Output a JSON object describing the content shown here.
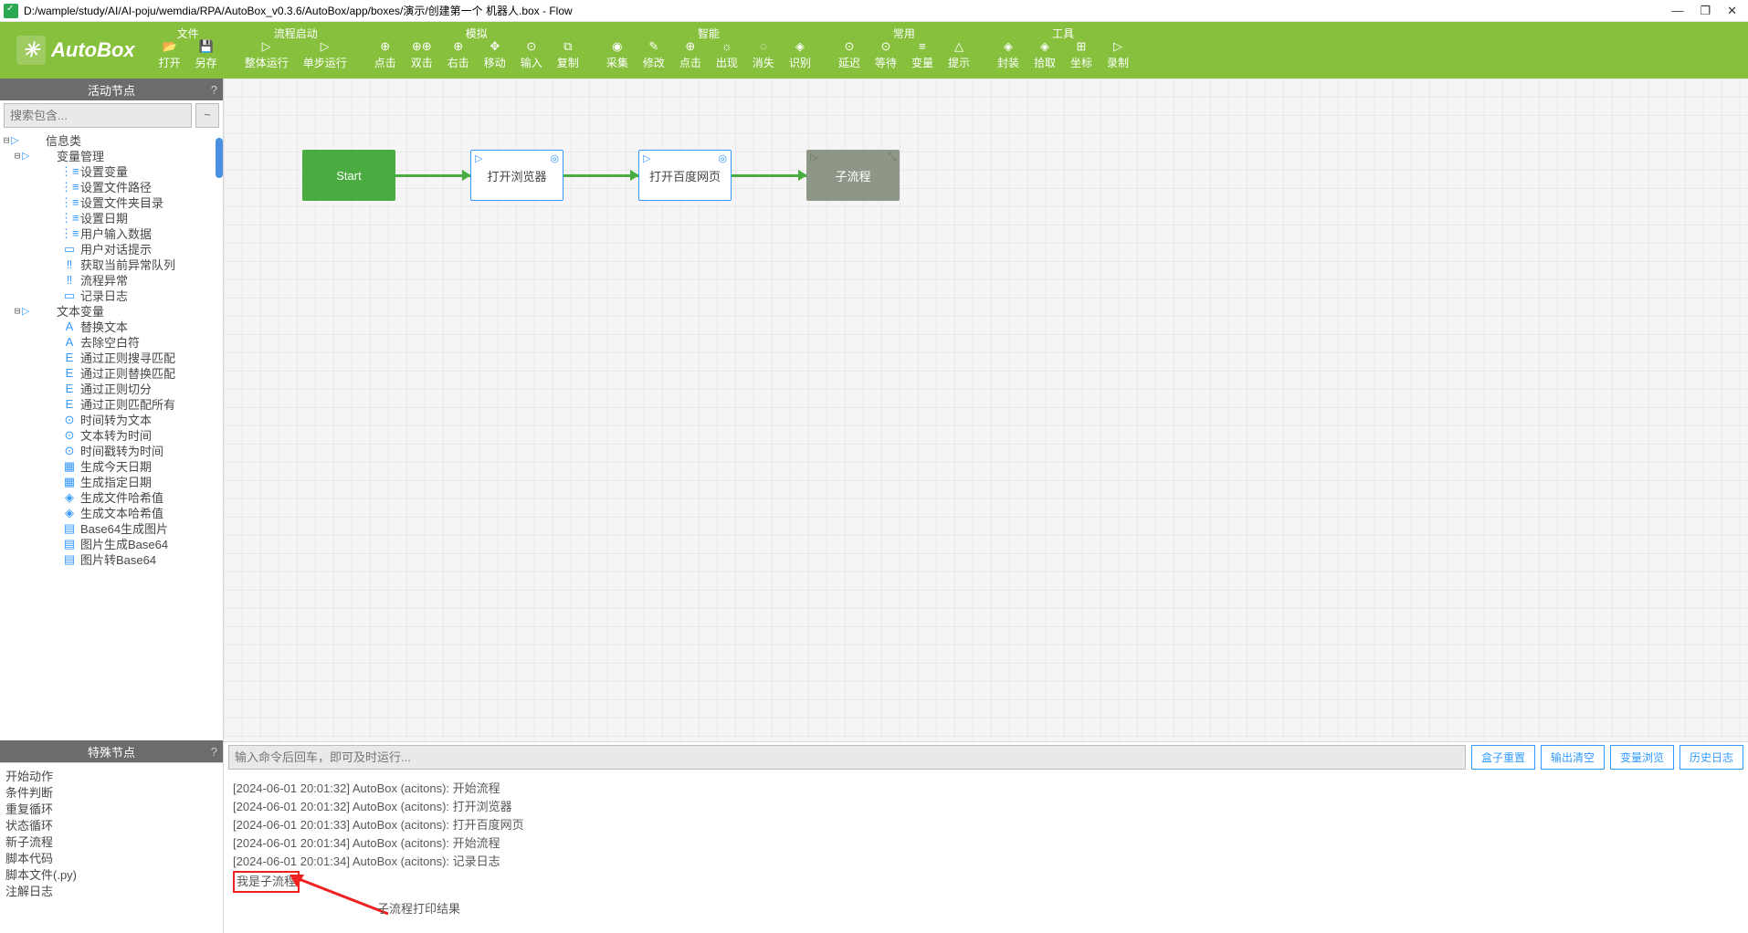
{
  "window": {
    "title": "D:/wample/study/AI/AI-poju/wemdia/RPA/AutoBox_v0.3.6/AutoBox/app/boxes/演示/创建第一个 机器人.box - Flow"
  },
  "logo": "AutoBox",
  "toolbar": {
    "groups": [
      {
        "title": "文件",
        "items": [
          {
            "icon": "📂",
            "label": "打开"
          },
          {
            "icon": "💾",
            "label": "另存"
          }
        ]
      },
      {
        "title": "流程启动",
        "items": [
          {
            "icon": "▷",
            "label": "整体运行"
          },
          {
            "icon": "▷",
            "label": "单步运行"
          }
        ]
      },
      {
        "title": "模拟",
        "items": [
          {
            "icon": "⊕",
            "label": "点击"
          },
          {
            "icon": "⊕⊕",
            "label": "双击"
          },
          {
            "icon": "⊕",
            "label": "右击"
          },
          {
            "icon": "✥",
            "label": "移动"
          },
          {
            "icon": "⊙",
            "label": "输入"
          },
          {
            "icon": "⧉",
            "label": "复制"
          }
        ]
      },
      {
        "title": "智能",
        "items": [
          {
            "icon": "◉",
            "label": "采集"
          },
          {
            "icon": "✎",
            "label": "修改"
          },
          {
            "icon": "⊕",
            "label": "点击"
          },
          {
            "icon": "☼",
            "label": "出现"
          },
          {
            "icon": "◌",
            "label": "消失"
          },
          {
            "icon": "◈",
            "label": "识别"
          }
        ]
      },
      {
        "title": "常用",
        "items": [
          {
            "icon": "⊙",
            "label": "延迟"
          },
          {
            "icon": "⊙",
            "label": "等待"
          },
          {
            "icon": "≡",
            "label": "变量"
          },
          {
            "icon": "△",
            "label": "提示"
          }
        ]
      },
      {
        "title": "工具",
        "items": [
          {
            "icon": "◈",
            "label": "封装"
          },
          {
            "icon": "◈",
            "label": "拾取"
          },
          {
            "icon": "⊞",
            "label": "坐标"
          },
          {
            "icon": "▷",
            "label": "录制"
          }
        ]
      }
    ]
  },
  "panels": {
    "activity_header": "活动节点",
    "special_header": "特殊节点",
    "search_placeholder": "搜索包含...",
    "tilde": "~"
  },
  "tree": [
    {
      "level": 0,
      "tog": "⊟",
      "arr": "▷",
      "icon": "",
      "label": "信息类"
    },
    {
      "level": 1,
      "tog": "⊟",
      "arr": "▷",
      "icon": "",
      "label": "变量管理"
    },
    {
      "level": 2,
      "tog": "",
      "arr": "",
      "icon": "⋮≡",
      "label": "设置变量"
    },
    {
      "level": 2,
      "tog": "",
      "arr": "",
      "icon": "⋮≡",
      "label": "设置文件路径"
    },
    {
      "level": 2,
      "tog": "",
      "arr": "",
      "icon": "⋮≡",
      "label": "设置文件夹目录"
    },
    {
      "level": 2,
      "tog": "",
      "arr": "",
      "icon": "⋮≡",
      "label": "设置日期"
    },
    {
      "level": 2,
      "tog": "",
      "arr": "",
      "icon": "⋮≡",
      "label": "用户输入数据"
    },
    {
      "level": 2,
      "tog": "",
      "arr": "",
      "icon": "▭",
      "label": "用户对话提示"
    },
    {
      "level": 2,
      "tog": "",
      "arr": "",
      "icon": "‼",
      "label": "获取当前异常队列"
    },
    {
      "level": 2,
      "tog": "",
      "arr": "",
      "icon": "‼",
      "label": "流程异常"
    },
    {
      "level": 2,
      "tog": "",
      "arr": "",
      "icon": "▭",
      "label": "记录日志"
    },
    {
      "level": 1,
      "tog": "⊟",
      "arr": "▷",
      "icon": "",
      "label": "文本变量"
    },
    {
      "level": 2,
      "tog": "",
      "arr": "",
      "icon": "A",
      "label": "替换文本"
    },
    {
      "level": 2,
      "tog": "",
      "arr": "",
      "icon": "A",
      "label": "去除空白符"
    },
    {
      "level": 2,
      "tog": "",
      "arr": "",
      "icon": "E",
      "label": "通过正则搜寻匹配"
    },
    {
      "level": 2,
      "tog": "",
      "arr": "",
      "icon": "E",
      "label": "通过正则替换匹配"
    },
    {
      "level": 2,
      "tog": "",
      "arr": "",
      "icon": "E",
      "label": "通过正则切分"
    },
    {
      "level": 2,
      "tog": "",
      "arr": "",
      "icon": "E",
      "label": "通过正则匹配所有"
    },
    {
      "level": 2,
      "tog": "",
      "arr": "",
      "icon": "⊙",
      "label": "时间转为文本"
    },
    {
      "level": 2,
      "tog": "",
      "arr": "",
      "icon": "⊙",
      "label": "文本转为时间"
    },
    {
      "level": 2,
      "tog": "",
      "arr": "",
      "icon": "⊙",
      "label": "时间戳转为时间"
    },
    {
      "level": 2,
      "tog": "",
      "arr": "",
      "icon": "▦",
      "label": "生成今天日期"
    },
    {
      "level": 2,
      "tog": "",
      "arr": "",
      "icon": "▦",
      "label": "生成指定日期"
    },
    {
      "level": 2,
      "tog": "",
      "arr": "",
      "icon": "◈",
      "label": "生成文件哈希值"
    },
    {
      "level": 2,
      "tog": "",
      "arr": "",
      "icon": "◈",
      "label": "生成文本哈希值"
    },
    {
      "level": 2,
      "tog": "",
      "arr": "",
      "icon": "▤",
      "label": "Base64生成图片"
    },
    {
      "level": 2,
      "tog": "",
      "arr": "",
      "icon": "▤",
      "label": "图片生成Base64"
    },
    {
      "level": 2,
      "tog": "",
      "arr": "",
      "icon": "▤",
      "label": "图片转Base64"
    }
  ],
  "special": [
    "开始动作",
    "条件判断",
    "重复循环",
    "状态循环",
    "新子流程",
    "脚本代码",
    "脚本文件(.py)",
    "注解日志"
  ],
  "flow": {
    "start": "Start",
    "n1": "打开浏览器",
    "n2": "打开百度网页",
    "n3": "子流程"
  },
  "console": {
    "cmd_placeholder": "输入命令后回车，即可及时运行...",
    "buttons": [
      "盒子重置",
      "输出清空",
      "变量浏览",
      "历史日志"
    ],
    "lines": [
      "[2024-06-01 20:01:32] AutoBox (acitons): 开始流程",
      "[2024-06-01 20:01:32] AutoBox (acitons): 打开浏览器",
      "[2024-06-01 20:01:33] AutoBox (acitons): 打开百度网页",
      "[2024-06-01 20:01:34] AutoBox (acitons): 开始流程",
      "[2024-06-01 20:01:34] AutoBox (acitons): 记录日志"
    ],
    "redline": "我是子流程"
  },
  "annotation": "子流程打印结果"
}
